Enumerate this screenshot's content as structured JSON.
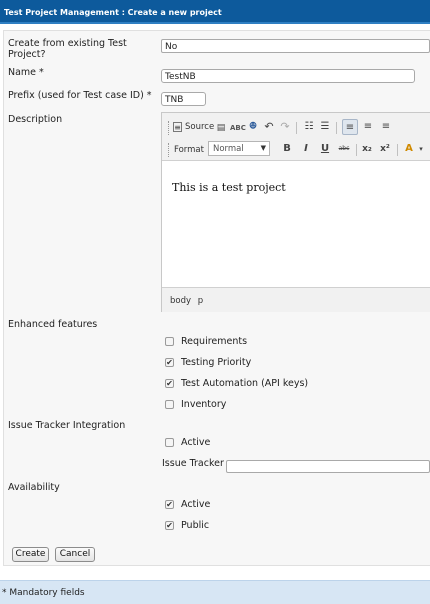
{
  "header": {
    "title": "Test Project Management : Create a new project"
  },
  "form": {
    "create_from_label_line1": "Create from existing Test",
    "create_from_label_line2": "Project?",
    "create_from_value": "No",
    "name_label": "Name *",
    "name_value": "TestNB",
    "prefix_label": "Prefix (used for Test case ID) *",
    "prefix_value": "TNB",
    "description_label": "Description",
    "editor": {
      "source_label": "Source",
      "format_label": "Format",
      "format_value": "Normal",
      "content": "This is a test project",
      "path_body": "body",
      "path_p": "p"
    },
    "enhanced_label": "Enhanced features",
    "features": [
      {
        "label": "Requirements",
        "checked": false
      },
      {
        "label": "Testing Priority",
        "checked": true
      },
      {
        "label": "Test Automation (API keys)",
        "checked": true
      },
      {
        "label": "Inventory",
        "checked": false
      }
    ],
    "issue_tracker_integration_label": "Issue Tracker Integration",
    "issue_active_label": "Active",
    "issue_active_checked": false,
    "issue_tracker_label": "Issue Tracker",
    "issue_tracker_value": "",
    "availability_label": "Availability",
    "availability": [
      {
        "label": "Active",
        "checked": true
      },
      {
        "label": "Public",
        "checked": true
      }
    ],
    "create_button": "Create",
    "cancel_button": "Cancel"
  },
  "footer": {
    "mandatory_note": "* Mandatory fields"
  }
}
